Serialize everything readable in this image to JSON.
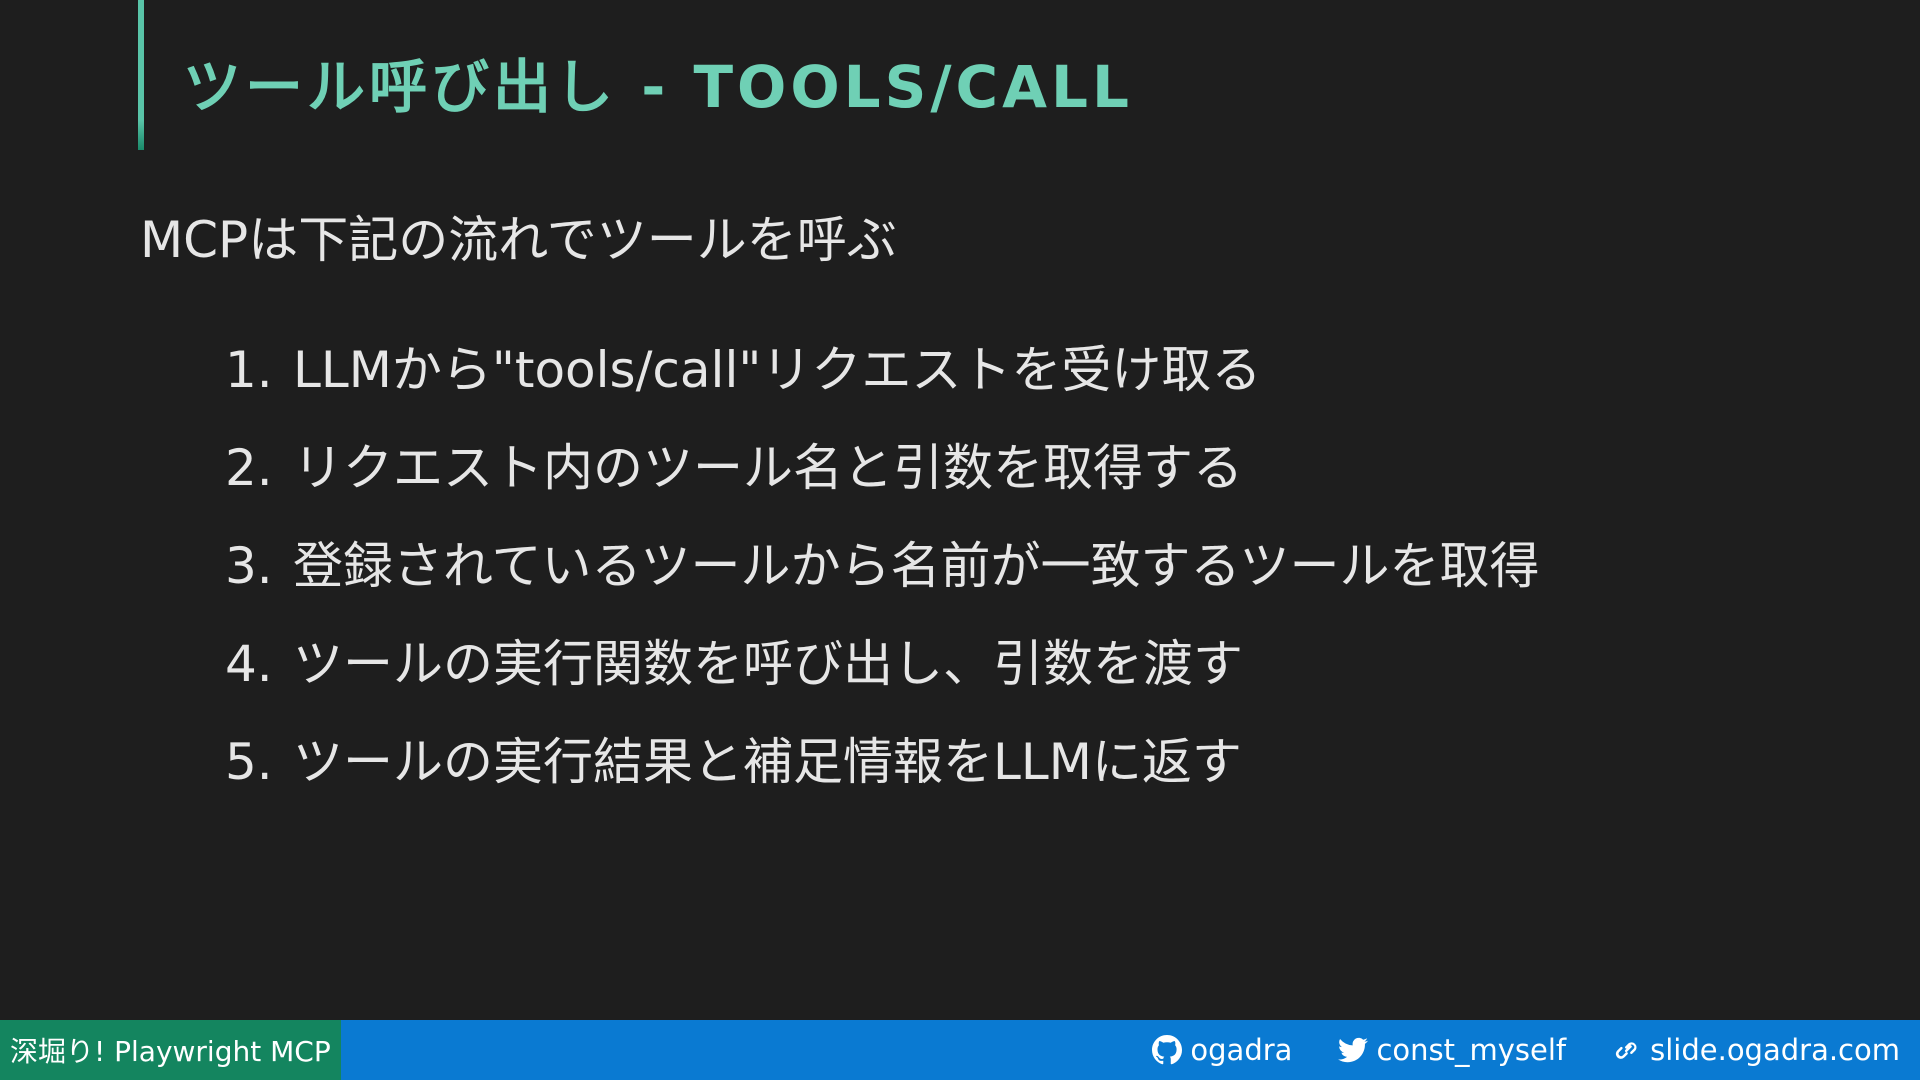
{
  "slide": {
    "title": "ツール呼び出し - TOOLS/CALL",
    "subtitle": "MCPは下記の流れでツールを呼ぶ",
    "steps": [
      {
        "num": "1.",
        "text": "LLMから\"tools/call\"リクエストを受け取る"
      },
      {
        "num": "2.",
        "text": "リクエスト内のツール名と引数を取得する"
      },
      {
        "num": "3.",
        "text": "登録されているツールから名前が一致するツールを取得"
      },
      {
        "num": "4.",
        "text": "ツールの実行関数を呼び出し、引数を渡す"
      },
      {
        "num": "5.",
        "text": "ツールの実行結果と補足情報をLLMに返す"
      }
    ]
  },
  "footer": {
    "deck_title": "深堀り! Playwright MCP",
    "links": [
      {
        "icon": "github-icon",
        "label": "ogadra"
      },
      {
        "icon": "twitter-icon",
        "label": "const_myself"
      },
      {
        "icon": "link-icon",
        "label": "slide.ogadra.com"
      }
    ]
  },
  "colors": {
    "background": "#1e1e1e",
    "title": "#6fd0b5",
    "accent_bar": "#59c4a8",
    "footer_bg": "#0a7ad2",
    "footer_label_bg": "#14855f"
  }
}
